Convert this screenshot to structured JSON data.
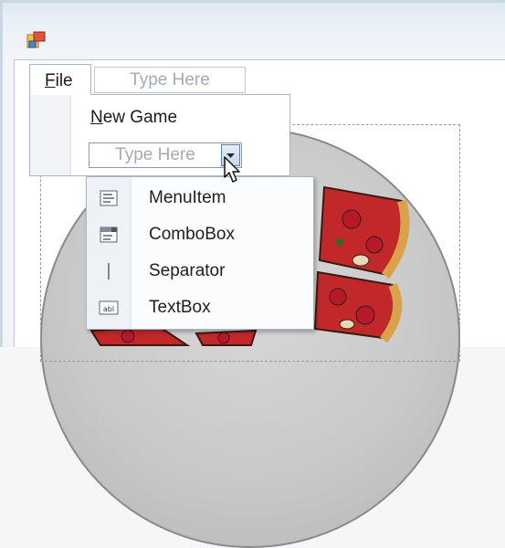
{
  "menu_bar": {
    "file_label_underlined": "F",
    "file_label_rest": "ile",
    "type_here_placeholder": "Type Here"
  },
  "file_dropdown": {
    "new_game_underlined": "N",
    "new_game_rest": "ew Game",
    "combo_placeholder": "Type Here"
  },
  "item_type_popup": {
    "items": [
      {
        "label": "MenuItem",
        "icon": "menu-item-icon"
      },
      {
        "label": "ComboBox",
        "icon": "combobox-icon"
      },
      {
        "label": "Separator",
        "icon": "separator-icon"
      },
      {
        "label": "TextBox",
        "icon": "textbox-icon"
      }
    ],
    "textbox_icon_text": "abl"
  },
  "colors": {
    "highlight": "#d9e9fb",
    "pizza_crust": "#d9a24a",
    "pizza_sauce": "#c0282a",
    "pepperoni": "#b7192b"
  }
}
